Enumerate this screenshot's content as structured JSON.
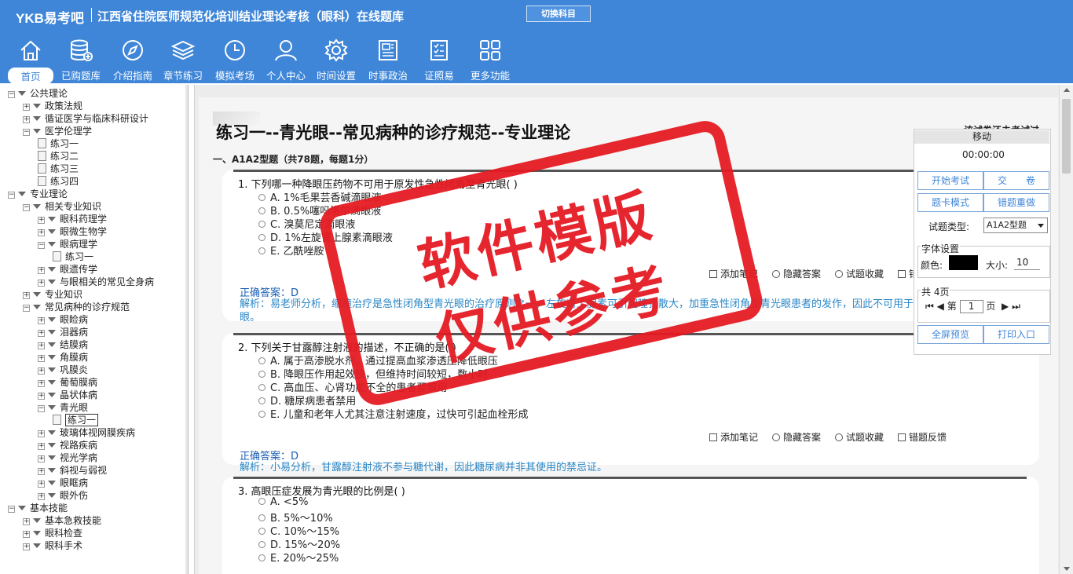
{
  "header": {
    "logo": "YKB易考吧",
    "title": "江西省住院医师规范化培训结业理论考核（眼科）在线题库",
    "switch_label": "切换科目",
    "nav": [
      {
        "label": "首页",
        "icon": "home-icon"
      },
      {
        "label": "已购题库",
        "icon": "database-icon"
      },
      {
        "label": "介绍指南",
        "icon": "compass-icon"
      },
      {
        "label": "章节练习",
        "icon": "layers-icon"
      },
      {
        "label": "模拟考场",
        "icon": "clock-icon"
      },
      {
        "label": "个人中心",
        "icon": "user-icon"
      },
      {
        "label": "时间设置",
        "icon": "gear-icon"
      },
      {
        "label": "时事政治",
        "icon": "news-icon"
      },
      {
        "label": "证照易",
        "icon": "checklist-icon"
      },
      {
        "label": "更多功能",
        "icon": "grid-icon"
      }
    ]
  },
  "tree": [
    {
      "label": "公共理论",
      "level": 0,
      "kind": "root-open"
    },
    {
      "label": "政策法规",
      "level": 1,
      "kind": "folder"
    },
    {
      "label": "循证医学与临床科研设计",
      "level": 1,
      "kind": "folder"
    },
    {
      "label": "医学伦理学",
      "level": 1,
      "kind": "folder-open"
    },
    {
      "label": "练习一",
      "level": 2,
      "kind": "doc"
    },
    {
      "label": "练习二",
      "level": 2,
      "kind": "doc"
    },
    {
      "label": "练习三",
      "level": 2,
      "kind": "doc"
    },
    {
      "label": "练习四",
      "level": 2,
      "kind": "doc"
    },
    {
      "label": "专业理论",
      "level": 0,
      "kind": "root-open"
    },
    {
      "label": "相关专业知识",
      "level": 1,
      "kind": "folder-open"
    },
    {
      "label": "眼科药理学",
      "level": 2,
      "kind": "folder"
    },
    {
      "label": "眼微生物学",
      "level": 2,
      "kind": "folder"
    },
    {
      "label": "眼病理学",
      "level": 2,
      "kind": "folder-open"
    },
    {
      "label": "练习一",
      "level": 3,
      "kind": "doc"
    },
    {
      "label": "眼遗传学",
      "level": 2,
      "kind": "folder"
    },
    {
      "label": "与眼相关的常见全身病",
      "level": 2,
      "kind": "folder"
    },
    {
      "label": "专业知识",
      "level": 1,
      "kind": "folder"
    },
    {
      "label": "常见病种的诊疗规范",
      "level": 1,
      "kind": "folder-open"
    },
    {
      "label": "眼睑病",
      "level": 2,
      "kind": "folder"
    },
    {
      "label": "泪器病",
      "level": 2,
      "kind": "folder"
    },
    {
      "label": "结膜病",
      "level": 2,
      "kind": "folder"
    },
    {
      "label": "角膜病",
      "level": 2,
      "kind": "folder"
    },
    {
      "label": "巩膜炎",
      "level": 2,
      "kind": "folder"
    },
    {
      "label": "葡萄膜病",
      "level": 2,
      "kind": "folder"
    },
    {
      "label": "晶状体病",
      "level": 2,
      "kind": "folder"
    },
    {
      "label": "青光眼",
      "level": 2,
      "kind": "folder-open"
    },
    {
      "label": "练习一",
      "level": 3,
      "kind": "doc-selected"
    },
    {
      "label": "玻璃体视网膜疾病",
      "level": 2,
      "kind": "folder"
    },
    {
      "label": "视路疾病",
      "level": 2,
      "kind": "folder"
    },
    {
      "label": "视光学病",
      "level": 2,
      "kind": "folder"
    },
    {
      "label": "斜视与弱视",
      "level": 2,
      "kind": "folder"
    },
    {
      "label": "眼眶病",
      "level": 2,
      "kind": "folder"
    },
    {
      "label": "眼外伤",
      "level": 2,
      "kind": "folder"
    },
    {
      "label": "基本技能",
      "level": 0,
      "kind": "root-open"
    },
    {
      "label": "基本急救技能",
      "level": 1,
      "kind": "folder"
    },
    {
      "label": "眼科检查",
      "level": 1,
      "kind": "folder"
    },
    {
      "label": "眼科手术",
      "level": 1,
      "kind": "folder"
    }
  ],
  "main": {
    "page_title": "练习一--青光眼--常见病种的诊疗规范--专业理论",
    "exam_status": "该试卷还未考试过",
    "section_title": "一、A1A2型题（共78题，每题1分）",
    "actions": {
      "note": "添加笔记",
      "hide": "隐藏答案",
      "fav": "试题收藏",
      "feedback": "错题反馈"
    },
    "answer_prefix": "正确答案：",
    "questions": [
      {
        "stem": "1. 下列哪一种降眼压药物不可用于原发性急性闭角型青光眼( )",
        "options": [
          "A. 1%毛果芸香碱滴眼液",
          "B. 0.5%噻吗洛尔滴眼液",
          "C. 溴莫尼定滴眼液",
          "D. 1%左旋肾上腺素滴眼液",
          "E. 乙酰唑胺"
        ],
        "answer": "正确答案：D",
        "analysis": "解析：易老师分析，缩瞳治疗是急性闭角型青光眼的治疗原则之一。左旋肾上腺素可引起瞳孔散大，加重急性闭角型青光眼患者的发作，因此不可用于急性闭角型青光眼。"
      },
      {
        "stem": "2. 下列关于甘露醇注射液的描述，不正确的是( )",
        "options": [
          "A. 属于高渗脱水剂，通过提高血浆渗透压降低眼压",
          "B. 降眼压作用起效快，但维持时间较短，数小时",
          "C. 高血压、心肾功能不全的患者要慎用",
          "D. 糖尿病患者禁用",
          "E. 儿童和老年人尤其注意注射速度，过快可引起血栓形成"
        ],
        "answer": "正确答案：D",
        "analysis": "解析：小易分析，甘露醇注射液不参与糖代谢，因此糖尿病并非其使用的禁忌证。"
      },
      {
        "stem": "3. 高眼压症发展为青光眼的比例是( )",
        "options": [
          "A. <5%",
          "B. 5%～10%",
          "C. 10%～15%",
          "D. 15%～20%",
          "E. 20%～25%"
        ]
      }
    ]
  },
  "control": {
    "move": "移动",
    "timer": "00:00:00",
    "start": "开始考试",
    "submit": "交　　卷",
    "card_mode": "题卡模式",
    "redo": "错题重做",
    "type_label": "试题类型:",
    "type_value": "A1A2型题",
    "font_group": "字体设置",
    "color_label": "颜色:",
    "size_label": "大小:",
    "size_value": "10",
    "pages_total": "共 4页",
    "page_prefix": "第",
    "page_value": "1",
    "page_suffix": "页",
    "full_preview": "全屏预览",
    "print": "打印入口"
  },
  "stamp": {
    "line1": "软件模版",
    "line2": "仅供参考"
  },
  "colors": {
    "header": "#3f86d8",
    "stamp": "#e51b23",
    "answer": "#1a5fb4",
    "analysis": "#2a87c7"
  }
}
